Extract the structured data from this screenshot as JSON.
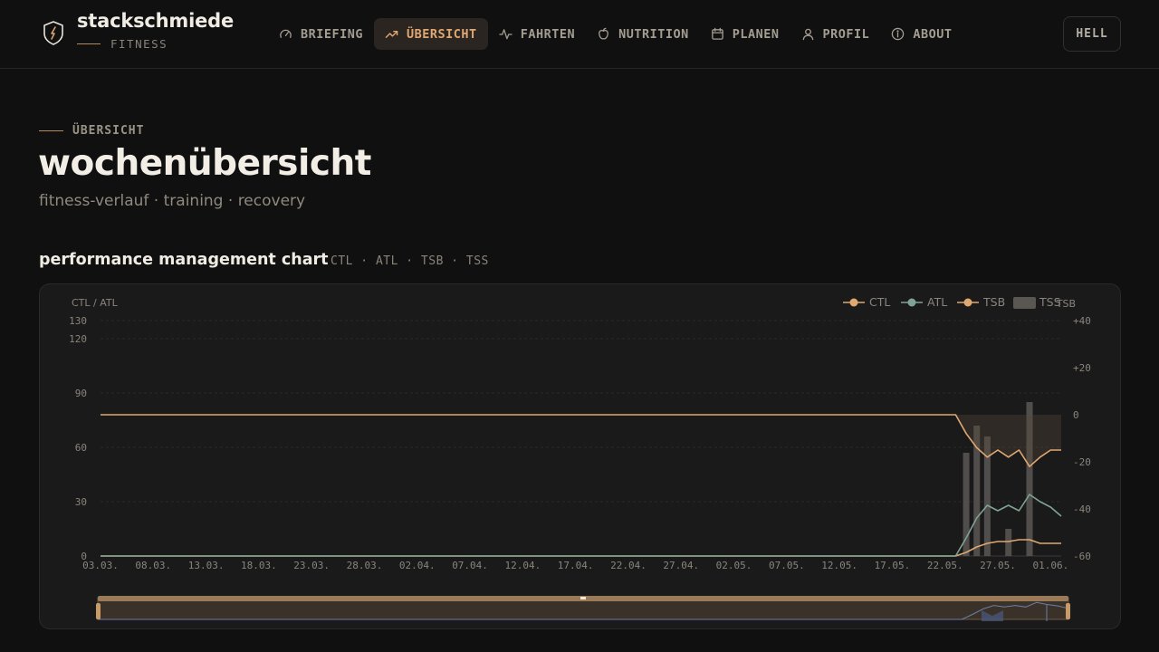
{
  "brand": {
    "name": "stackschmiede",
    "sub": "FITNESS"
  },
  "nav": [
    {
      "label": "BRIEFING",
      "icon": "gauge-icon",
      "active": false
    },
    {
      "label": "ÜBERSICHT",
      "icon": "trending-up-icon",
      "active": true
    },
    {
      "label": "FAHRTEN",
      "icon": "activity-icon",
      "active": false
    },
    {
      "label": "NUTRITION",
      "icon": "apple-icon",
      "active": false
    },
    {
      "label": "PLANEN",
      "icon": "calendar-icon",
      "active": false
    },
    {
      "label": "PROFIL",
      "icon": "user-icon",
      "active": false
    },
    {
      "label": "ABOUT",
      "icon": "info-icon",
      "active": false
    }
  ],
  "theme_toggle": "HELL",
  "section": {
    "eyebrow": "ÜBERSICHT",
    "title": "wochenübersicht",
    "subtitle": "fitness-verlauf · training · recovery"
  },
  "chart_section": {
    "title": "performance management chart",
    "tags": "CTL · ATL · TSB · TSS"
  },
  "colors": {
    "accent": "#e0a871",
    "ctl": "#e0a871",
    "atl": "#7fa394",
    "tsb": "#e0a871",
    "tss": "#5a5753"
  },
  "chart_data": {
    "type": "line",
    "left_axis_label": "CTL / ATL",
    "right_axis_label": "TSB",
    "y_left_ticks": [
      0,
      30,
      60,
      90,
      120,
      130
    ],
    "y_left_range": [
      0,
      130
    ],
    "y_right_ticks": [
      "+40",
      "+20",
      "0",
      "-20",
      "-40",
      "-60"
    ],
    "y_right_range": [
      -60,
      40
    ],
    "x_tick_labels": [
      "03.03.",
      "08.03.",
      "13.03.",
      "18.03.",
      "23.03.",
      "28.03.",
      "02.04.",
      "07.04.",
      "12.04.",
      "17.04.",
      "22.04.",
      "27.04.",
      "02.05.",
      "07.05.",
      "12.05.",
      "17.05.",
      "22.05.",
      "27.05.",
      "01.06."
    ],
    "x_range_days": [
      0,
      91
    ],
    "legend": [
      "CTL",
      "ATL",
      "TSB",
      "TSS"
    ],
    "legend_position": "top-right",
    "grid": true,
    "series": [
      {
        "name": "CTL",
        "axis": "left",
        "days": [
          0,
          81,
          82,
          83,
          84,
          85,
          86,
          87,
          88,
          89,
          90,
          91
        ],
        "values": [
          0,
          0,
          2,
          5,
          7,
          8,
          8,
          9,
          9,
          7,
          7,
          7
        ]
      },
      {
        "name": "ATL",
        "axis": "left",
        "days": [
          0,
          81,
          82,
          83,
          84,
          85,
          86,
          87,
          88,
          89,
          90,
          91
        ],
        "values": [
          0,
          0,
          10,
          21,
          28,
          25,
          28,
          25,
          34,
          30,
          27,
          22
        ]
      },
      {
        "name": "TSB",
        "axis": "right",
        "days": [
          0,
          81,
          82,
          83,
          84,
          85,
          86,
          87,
          88,
          89,
          90,
          91
        ],
        "values": [
          0,
          0,
          -8,
          -14,
          -18,
          -15,
          -18,
          -15,
          -22,
          -18,
          -15,
          -15
        ]
      }
    ],
    "tss": {
      "name": "TSS",
      "days": [
        82,
        83,
        84,
        86,
        88
      ],
      "values": [
        57,
        72,
        66,
        15,
        85
      ],
      "scale_max": 130
    }
  }
}
